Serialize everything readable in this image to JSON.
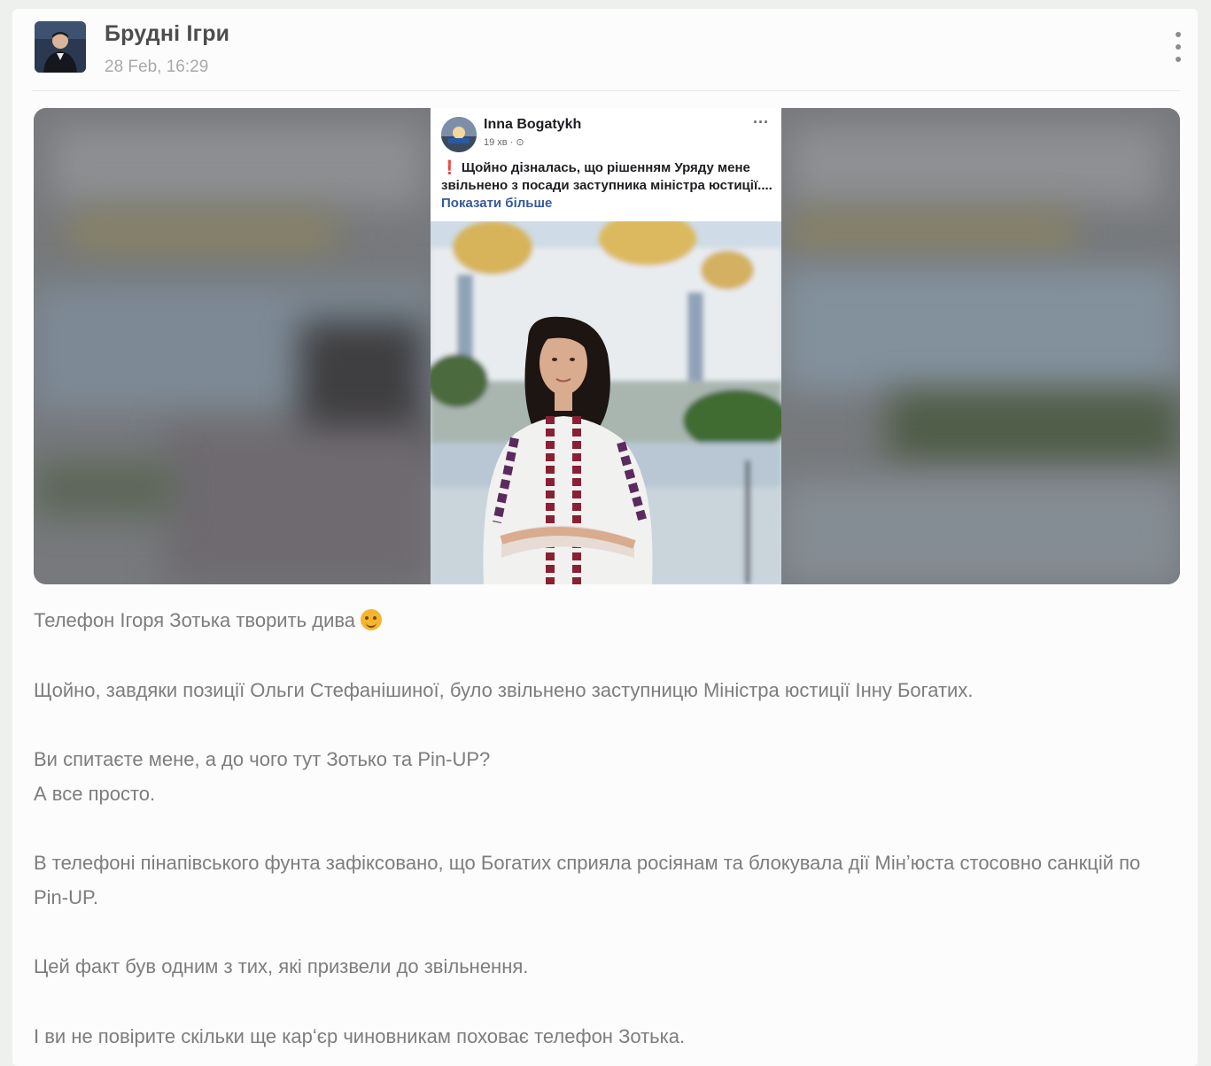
{
  "channel": {
    "name": "Брудні Ігри",
    "timestamp": "28 Feb, 16:29"
  },
  "media": {
    "fb_post": {
      "author": "Inna Bogatykh",
      "meta": "19 хв · ⊙",
      "text_marker": "❗",
      "text": "Щойно дізналась, що рішенням Уряду мене звільнено з посади заступника міністра юстиції....",
      "more_link": "Показати більше"
    }
  },
  "post": {
    "paragraphs": [
      "Телефон Ігоря Зотька творить дива",
      "Щойно, завдяки позиції Ольги Стефанішиної, було звільнено заступницю Міністра юстиції Інну Богатих.",
      "Ви спитаєте мене, а до чого тут Зотько та Pin-UP?",
      "А все просто.",
      "В телефоні пінапівського фунта зафіксовано, що Богатих сприяла росіянам та блокувала дії Мінʼюста стосовно санкцій по Pin-UP.",
      "Цей факт був одним з тих, які призвели до звільнення.",
      "І ви не повірите скільки ще карʻєр чиновникам поховає телефон Зотька."
    ],
    "emoji": "wink-tongue-emoji"
  }
}
